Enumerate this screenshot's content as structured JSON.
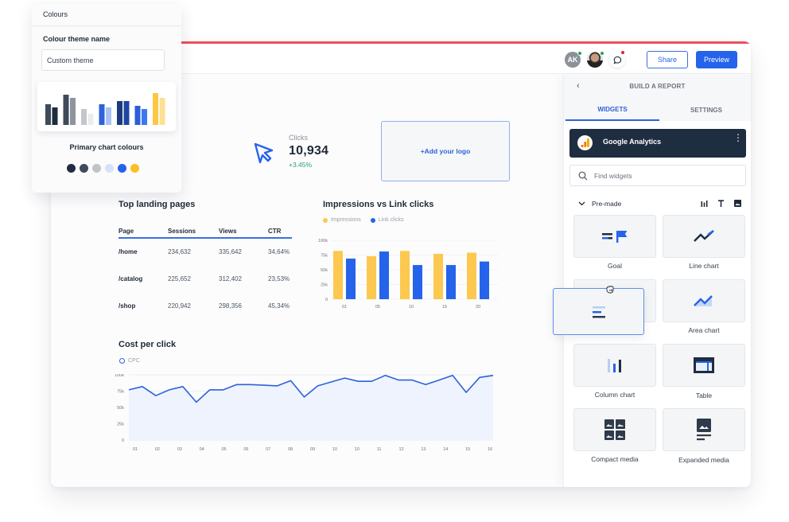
{
  "topbar": {
    "avatar_initials": "AK",
    "share_label": "Share",
    "preview_label": "Preview",
    "status_colors": {
      "online": "#22a55b",
      "notification": "#e02424"
    }
  },
  "colours_panel": {
    "title": "Colours",
    "theme_name_label": "Colour theme name",
    "theme_name_value": "Custom theme",
    "primary_label": "Primary chart colours",
    "swatch_pairs": [
      [
        "#3f4a5a",
        "#1f2d40"
      ],
      [
        "#3f4a5a",
        "#8e949c"
      ],
      [
        "#c3c6cb",
        "#ececed"
      ],
      [
        "#2d62d8",
        "#a9c2f4"
      ],
      [
        "#1c3a7d",
        "#2046a3"
      ],
      [
        "#2a5fd9",
        "#3e78ee"
      ],
      [
        "#fbc744",
        "#fde094"
      ]
    ],
    "primary_colors": [
      "#1f2d40",
      "#3f4a5a",
      "#c0c3c8",
      "#d6e2fb",
      "#2563eb",
      "#fbbf24"
    ]
  },
  "clicks_widget": {
    "label": "Clicks",
    "value": "10,934",
    "delta": "+3.45%",
    "icon": "cursor-arrow-icon"
  },
  "logo_widget": {
    "label": "+Add your logo"
  },
  "landing_pages": {
    "title": "Top landing pages",
    "columns": [
      "Page",
      "Sessions",
      "Views",
      "CTR"
    ],
    "rows": [
      [
        "/home",
        "234,632",
        "335,642",
        "34,64%"
      ],
      [
        "/catalog",
        "225,652",
        "312,402",
        "23,53%"
      ],
      [
        "/shop",
        "220,942",
        "298,356",
        "45,34%"
      ]
    ]
  },
  "chart_data": [
    {
      "type": "bar",
      "title": "Impressions vs Link clicks",
      "categories": [
        "01",
        "05",
        "10",
        "15",
        "20"
      ],
      "series": [
        {
          "name": "Impressions",
          "color": "#fcc84f",
          "values": [
            82000,
            73000,
            82000,
            77000,
            79000
          ]
        },
        {
          "name": "Link clicks",
          "color": "#2563eb",
          "values": [
            69000,
            81000,
            58000,
            58000,
            64000
          ]
        }
      ],
      "yticks": [
        "0",
        "25k",
        "50k",
        "75k",
        "100k"
      ],
      "ylim": [
        0,
        100000
      ],
      "xlabel": "",
      "ylabel": "",
      "legend": "top-left",
      "grid": true
    },
    {
      "type": "area",
      "title": "Cost per click",
      "series": [
        {
          "name": "CPC",
          "color": "#2d62d8",
          "values": [
            77000,
            82000,
            68000,
            77000,
            82000,
            58000,
            77000,
            77000,
            85000,
            85000,
            84000,
            83000,
            91000,
            66000,
            83000,
            89000,
            95000,
            90000,
            90000,
            99000,
            92000,
            92000,
            85000,
            92000,
            99000,
            73000,
            96000,
            99000
          ]
        }
      ],
      "categories": [
        "01",
        "02",
        "03",
        "04",
        "05",
        "06",
        "07",
        "08",
        "09",
        "10",
        "10",
        "11",
        "12",
        "13",
        "14",
        "15",
        "16"
      ],
      "yticks": [
        "0",
        "25k",
        "50k",
        "75k",
        "100k"
      ],
      "ylim": [
        0,
        100000
      ],
      "xlabel": "",
      "ylabel": "",
      "legend": "top-left",
      "grid": true
    }
  ],
  "builder_panel": {
    "title": "BUILD A REPORT",
    "tabs": [
      {
        "label": "WIDGETS",
        "active": true
      },
      {
        "label": "SETTINGS",
        "active": false
      }
    ],
    "source": {
      "name": "Google Analytics"
    },
    "search_placeholder": "Find widgets",
    "section_label": "Pre-made",
    "widgets": [
      {
        "label": "Goal",
        "icon": "goal-flag-icon"
      },
      {
        "label": "Line chart",
        "icon": "line-chart-icon"
      },
      {
        "label": "",
        "icon": "bar-list-icon"
      },
      {
        "label": "Area chart",
        "icon": "area-chart-icon"
      },
      {
        "label": "Column chart",
        "icon": "column-chart-icon"
      },
      {
        "label": "Table",
        "icon": "table-icon"
      },
      {
        "label": "Compact media",
        "icon": "compact-media-icon"
      },
      {
        "label": "Expanded media",
        "icon": "expanded-media-icon"
      }
    ]
  }
}
